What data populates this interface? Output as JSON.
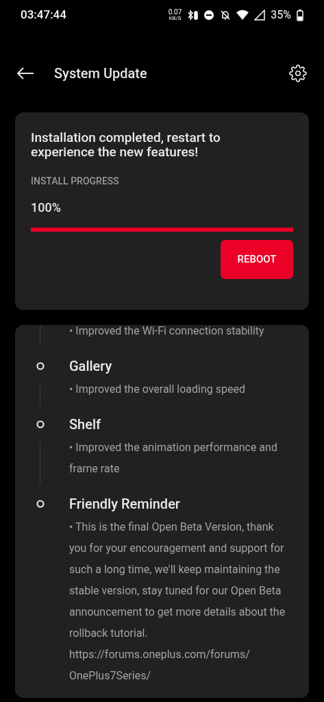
{
  "status_bar": {
    "time": "03:47:44",
    "net_speed": "0.07",
    "net_unit": "KB/S",
    "battery": "35%"
  },
  "header": {
    "title": "System Update"
  },
  "install_card": {
    "message": "Installation completed, restart to experience the new features!",
    "progress_label": "INSTALL PROGRESS",
    "progress_text": "100%",
    "level": 1,
    "button": "REBOOT"
  },
  "changelog": [
    {
      "body": "• Improved the Wi-Fi connection stability"
    },
    {
      "title": "Gallery",
      "body": "• Improved the overall loading speed"
    },
    {
      "title": "Shelf",
      "body": "• Improved the animation performance and frame rate"
    },
    {
      "title": "Friendly Reminder",
      "body": "• This is the final Open Beta Version, thank you for your encouragement and support for such a long time, we'll keep maintaining the stable version, stay tuned for our Open Beta announcement to get more details about the rollback tutorial.",
      "link": "https://forums.oneplus.com/forums/OnePlus7Series/"
    }
  ]
}
